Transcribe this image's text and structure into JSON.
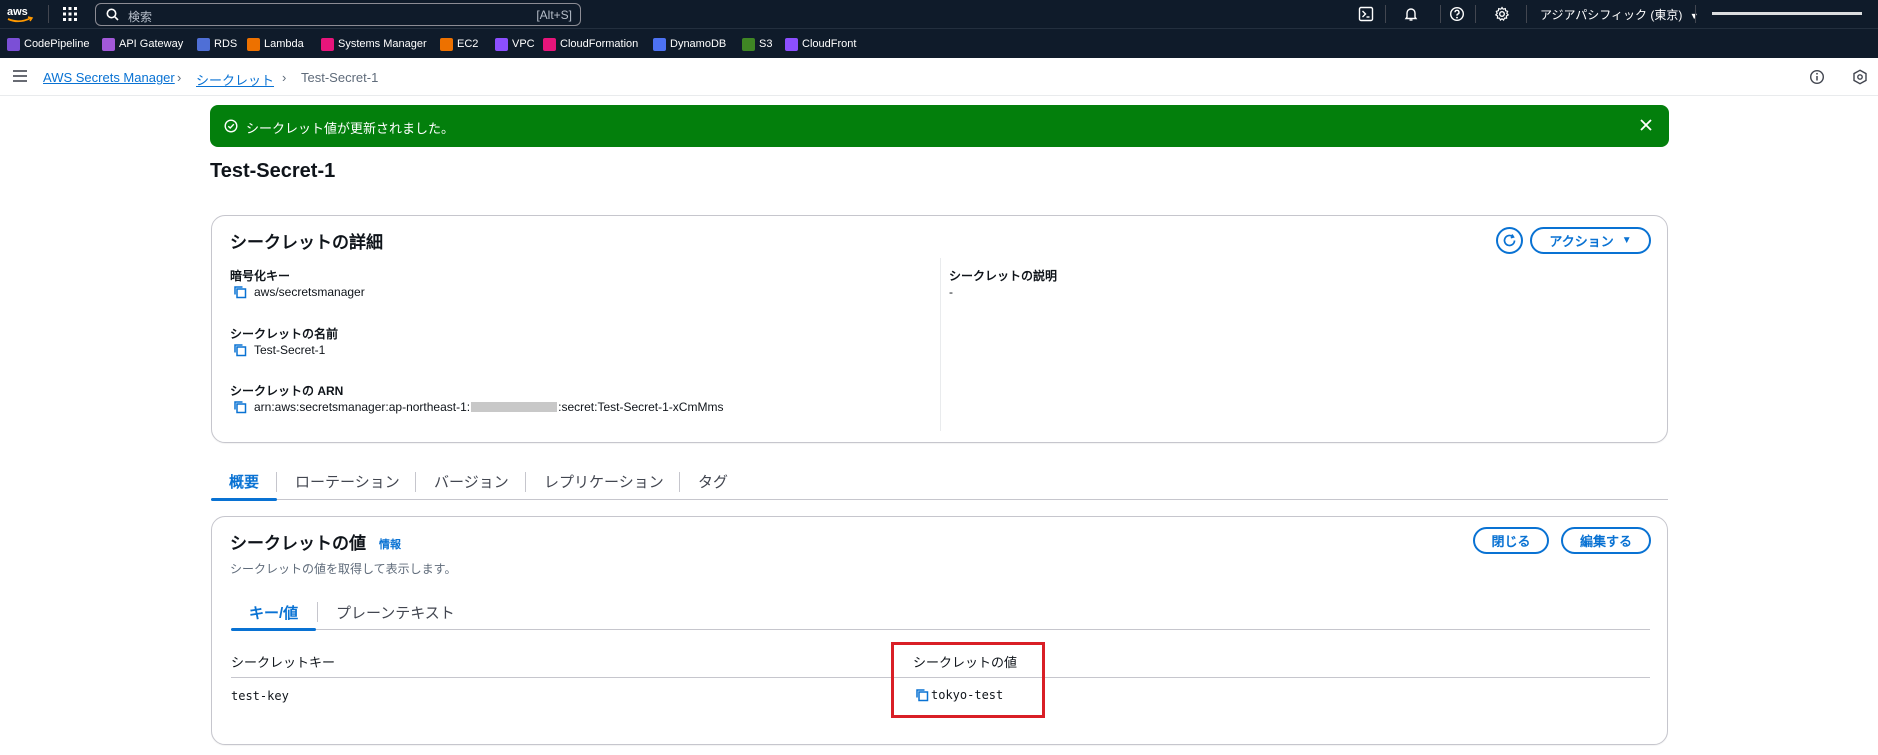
{
  "topnav": {
    "search_placeholder": "検索",
    "search_shortcut": "[Alt+S]",
    "region": "アジアパシフィック (東京)"
  },
  "favorites": [
    {
      "label": "CodePipeline",
      "color": "#7b4fd6"
    },
    {
      "label": "API Gateway",
      "color": "#a259d9"
    },
    {
      "label": "RDS",
      "color": "#4f6fd6"
    },
    {
      "label": "Lambda",
      "color": "#ed7100"
    },
    {
      "label": "Systems Manager",
      "color": "#e7157b"
    },
    {
      "label": "EC2",
      "color": "#ed7100"
    },
    {
      "label": "VPC",
      "color": "#8c4fff"
    },
    {
      "label": "CloudFormation",
      "color": "#e7157b"
    },
    {
      "label": "DynamoDB",
      "color": "#4d72f3"
    },
    {
      "label": "S3",
      "color": "#3f8624"
    },
    {
      "label": "CloudFront",
      "color": "#8c4fff"
    }
  ],
  "breadcrumb": {
    "service": "AWS Secrets Manager",
    "section": "シークレット",
    "current": "Test-Secret-1"
  },
  "flash": {
    "message": "シークレット値が更新されました。"
  },
  "page_title": "Test-Secret-1",
  "details": {
    "title": "シークレットの詳細",
    "actions_label": "アクション",
    "encryption_key_label": "暗号化キー",
    "encryption_key_value": "aws/secretsmanager",
    "name_label": "シークレットの名前",
    "name_value": "Test-Secret-1",
    "arn_label": "シークレットの ARN",
    "arn_prefix": "arn:aws:secretsmanager:ap-northeast-1:",
    "arn_suffix": ":secret:Test-Secret-1-xCmMms",
    "description_label": "シークレットの説明",
    "description_value": "-"
  },
  "tabs": [
    "概要",
    "ローテーション",
    "バージョン",
    "レプリケーション",
    "タグ"
  ],
  "secret_value": {
    "title": "シークレットの値",
    "info_link": "情報",
    "description": "シークレットの値を取得して表示します。",
    "close_label": "閉じる",
    "edit_label": "編集する",
    "subtabs": [
      "キー/値",
      "プレーンテキスト"
    ],
    "col_key": "シークレットキー",
    "col_value": "シークレットの値",
    "row_key": "test-key",
    "row_value": "tokyo-test"
  },
  "colors": {
    "brand_link": "#0972d3",
    "success": "#037f0c",
    "nav_bg": "#0f1b2a",
    "highlight": "#d91f26"
  }
}
